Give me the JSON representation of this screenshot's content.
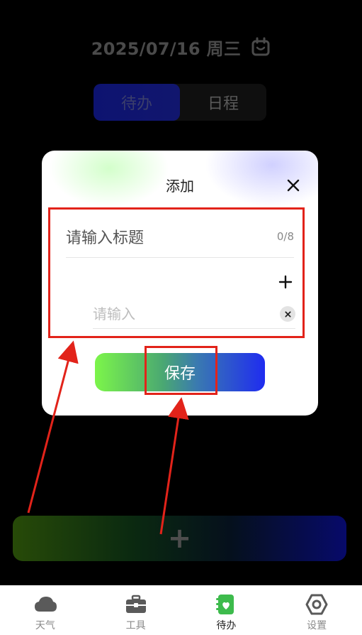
{
  "header": {
    "date": "2025/07/16 周三",
    "calendar_icon": "calendar-icon"
  },
  "segment": {
    "tabs": [
      {
        "label": "待办",
        "active": true
      },
      {
        "label": "日程",
        "active": false
      }
    ]
  },
  "add_bar": {
    "icon": "plus-icon"
  },
  "modal": {
    "title": "添加",
    "close_icon": "close-icon",
    "title_field": {
      "placeholder": "请输入标题",
      "value": "",
      "counter": "0/8"
    },
    "add_item_icon": "plus-icon",
    "item_field": {
      "placeholder": "请输入",
      "value": ""
    },
    "clear_icon": "clear-icon",
    "save_label": "保存"
  },
  "tabbar": {
    "items": [
      {
        "label": "天气",
        "icon": "cloud-icon",
        "active": false
      },
      {
        "label": "工具",
        "icon": "toolbox-icon",
        "active": false
      },
      {
        "label": "待办",
        "icon": "todo-icon",
        "active": true
      },
      {
        "label": "设置",
        "icon": "settings-icon",
        "active": false
      }
    ]
  },
  "colors": {
    "annotation_red": "#e2231a",
    "save_gradient_start": "#7cf54a",
    "save_gradient_end": "#1f2cf0"
  }
}
